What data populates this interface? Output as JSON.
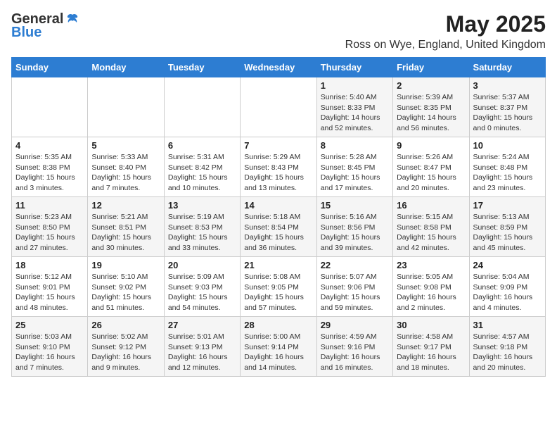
{
  "logo": {
    "general": "General",
    "blue": "Blue"
  },
  "title": {
    "month_year": "May 2025",
    "location": "Ross on Wye, England, United Kingdom"
  },
  "days_of_week": [
    "Sunday",
    "Monday",
    "Tuesday",
    "Wednesday",
    "Thursday",
    "Friday",
    "Saturday"
  ],
  "weeks": [
    [
      {
        "day": "",
        "info": ""
      },
      {
        "day": "",
        "info": ""
      },
      {
        "day": "",
        "info": ""
      },
      {
        "day": "",
        "info": ""
      },
      {
        "day": "1",
        "info": "Sunrise: 5:40 AM\nSunset: 8:33 PM\nDaylight: 14 hours and 52 minutes."
      },
      {
        "day": "2",
        "info": "Sunrise: 5:39 AM\nSunset: 8:35 PM\nDaylight: 14 hours and 56 minutes."
      },
      {
        "day": "3",
        "info": "Sunrise: 5:37 AM\nSunset: 8:37 PM\nDaylight: 15 hours and 0 minutes."
      }
    ],
    [
      {
        "day": "4",
        "info": "Sunrise: 5:35 AM\nSunset: 8:38 PM\nDaylight: 15 hours and 3 minutes."
      },
      {
        "day": "5",
        "info": "Sunrise: 5:33 AM\nSunset: 8:40 PM\nDaylight: 15 hours and 7 minutes."
      },
      {
        "day": "6",
        "info": "Sunrise: 5:31 AM\nSunset: 8:42 PM\nDaylight: 15 hours and 10 minutes."
      },
      {
        "day": "7",
        "info": "Sunrise: 5:29 AM\nSunset: 8:43 PM\nDaylight: 15 hours and 13 minutes."
      },
      {
        "day": "8",
        "info": "Sunrise: 5:28 AM\nSunset: 8:45 PM\nDaylight: 15 hours and 17 minutes."
      },
      {
        "day": "9",
        "info": "Sunrise: 5:26 AM\nSunset: 8:47 PM\nDaylight: 15 hours and 20 minutes."
      },
      {
        "day": "10",
        "info": "Sunrise: 5:24 AM\nSunset: 8:48 PM\nDaylight: 15 hours and 23 minutes."
      }
    ],
    [
      {
        "day": "11",
        "info": "Sunrise: 5:23 AM\nSunset: 8:50 PM\nDaylight: 15 hours and 27 minutes."
      },
      {
        "day": "12",
        "info": "Sunrise: 5:21 AM\nSunset: 8:51 PM\nDaylight: 15 hours and 30 minutes."
      },
      {
        "day": "13",
        "info": "Sunrise: 5:19 AM\nSunset: 8:53 PM\nDaylight: 15 hours and 33 minutes."
      },
      {
        "day": "14",
        "info": "Sunrise: 5:18 AM\nSunset: 8:54 PM\nDaylight: 15 hours and 36 minutes."
      },
      {
        "day": "15",
        "info": "Sunrise: 5:16 AM\nSunset: 8:56 PM\nDaylight: 15 hours and 39 minutes."
      },
      {
        "day": "16",
        "info": "Sunrise: 5:15 AM\nSunset: 8:58 PM\nDaylight: 15 hours and 42 minutes."
      },
      {
        "day": "17",
        "info": "Sunrise: 5:13 AM\nSunset: 8:59 PM\nDaylight: 15 hours and 45 minutes."
      }
    ],
    [
      {
        "day": "18",
        "info": "Sunrise: 5:12 AM\nSunset: 9:01 PM\nDaylight: 15 hours and 48 minutes."
      },
      {
        "day": "19",
        "info": "Sunrise: 5:10 AM\nSunset: 9:02 PM\nDaylight: 15 hours and 51 minutes."
      },
      {
        "day": "20",
        "info": "Sunrise: 5:09 AM\nSunset: 9:03 PM\nDaylight: 15 hours and 54 minutes."
      },
      {
        "day": "21",
        "info": "Sunrise: 5:08 AM\nSunset: 9:05 PM\nDaylight: 15 hours and 57 minutes."
      },
      {
        "day": "22",
        "info": "Sunrise: 5:07 AM\nSunset: 9:06 PM\nDaylight: 15 hours and 59 minutes."
      },
      {
        "day": "23",
        "info": "Sunrise: 5:05 AM\nSunset: 9:08 PM\nDaylight: 16 hours and 2 minutes."
      },
      {
        "day": "24",
        "info": "Sunrise: 5:04 AM\nSunset: 9:09 PM\nDaylight: 16 hours and 4 minutes."
      }
    ],
    [
      {
        "day": "25",
        "info": "Sunrise: 5:03 AM\nSunset: 9:10 PM\nDaylight: 16 hours and 7 minutes."
      },
      {
        "day": "26",
        "info": "Sunrise: 5:02 AM\nSunset: 9:12 PM\nDaylight: 16 hours and 9 minutes."
      },
      {
        "day": "27",
        "info": "Sunrise: 5:01 AM\nSunset: 9:13 PM\nDaylight: 16 hours and 12 minutes."
      },
      {
        "day": "28",
        "info": "Sunrise: 5:00 AM\nSunset: 9:14 PM\nDaylight: 16 hours and 14 minutes."
      },
      {
        "day": "29",
        "info": "Sunrise: 4:59 AM\nSunset: 9:16 PM\nDaylight: 16 hours and 16 minutes."
      },
      {
        "day": "30",
        "info": "Sunrise: 4:58 AM\nSunset: 9:17 PM\nDaylight: 16 hours and 18 minutes."
      },
      {
        "day": "31",
        "info": "Sunrise: 4:57 AM\nSunset: 9:18 PM\nDaylight: 16 hours and 20 minutes."
      }
    ]
  ]
}
